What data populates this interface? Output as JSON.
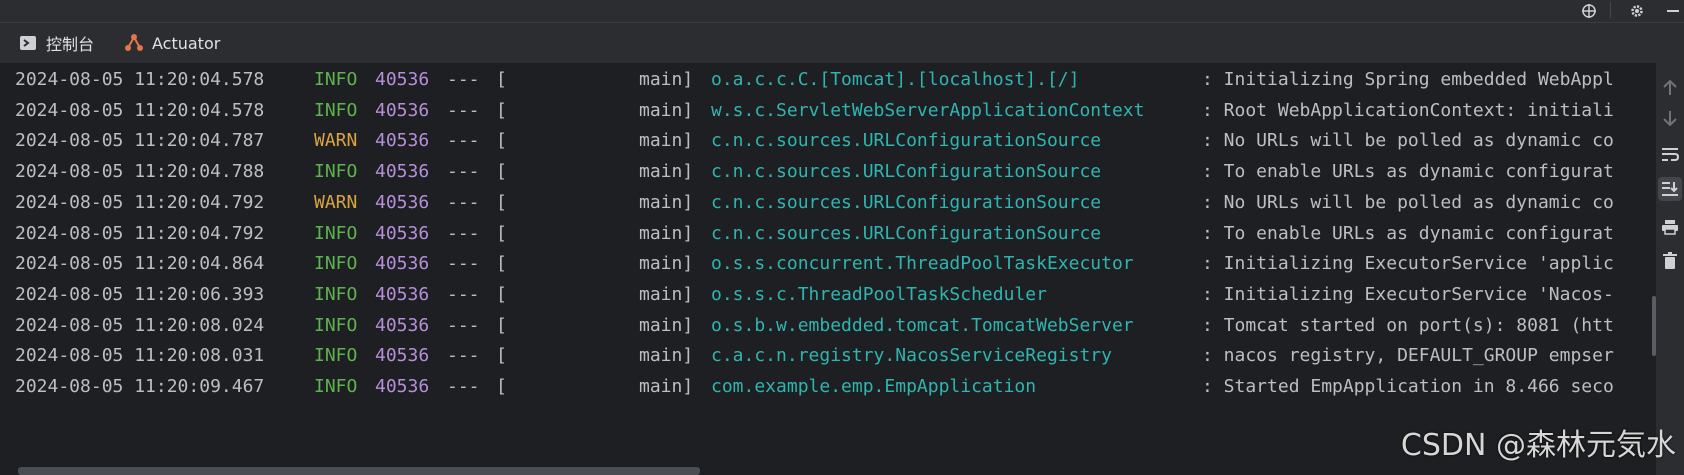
{
  "tabs": [
    {
      "label": "控制台",
      "icon": "console-icon"
    },
    {
      "label": "Actuator",
      "icon": "actuator-icon"
    }
  ],
  "top_icons": [
    "crosshair-icon",
    "gear-icon"
  ],
  "side_icons": [
    "arrow-up-icon",
    "arrow-down-icon",
    "soft-wrap-icon",
    "scroll-to-end-icon",
    "print-icon",
    "trash-icon"
  ],
  "log_lines": [
    {
      "timestamp": "2024-08-05 11:20:04.578",
      "level": "INFO",
      "pid": "40536",
      "sep": "---",
      "bracket": "[",
      "thread": "main]",
      "logger": "o.a.c.c.C.[Tomcat].[localhost].[/]",
      "message": ": Initializing Spring embedded WebAppl"
    },
    {
      "timestamp": "2024-08-05 11:20:04.578",
      "level": "INFO",
      "pid": "40536",
      "sep": "---",
      "bracket": "[",
      "thread": "main]",
      "logger": "w.s.c.ServletWebServerApplicationContext",
      "message": ": Root WebApplicationContext: initiali"
    },
    {
      "timestamp": "2024-08-05 11:20:04.787",
      "level": "WARN",
      "pid": "40536",
      "sep": "---",
      "bracket": "[",
      "thread": "main]",
      "logger": "c.n.c.sources.URLConfigurationSource",
      "message": ": No URLs will be polled as dynamic co"
    },
    {
      "timestamp": "2024-08-05 11:20:04.788",
      "level": "INFO",
      "pid": "40536",
      "sep": "---",
      "bracket": "[",
      "thread": "main]",
      "logger": "c.n.c.sources.URLConfigurationSource",
      "message": ": To enable URLs as dynamic configurat"
    },
    {
      "timestamp": "2024-08-05 11:20:04.792",
      "level": "WARN",
      "pid": "40536",
      "sep": "---",
      "bracket": "[",
      "thread": "main]",
      "logger": "c.n.c.sources.URLConfigurationSource",
      "message": ": No URLs will be polled as dynamic co"
    },
    {
      "timestamp": "2024-08-05 11:20:04.792",
      "level": "INFO",
      "pid": "40536",
      "sep": "---",
      "bracket": "[",
      "thread": "main]",
      "logger": "c.n.c.sources.URLConfigurationSource",
      "message": ": To enable URLs as dynamic configurat"
    },
    {
      "timestamp": "2024-08-05 11:20:04.864",
      "level": "INFO",
      "pid": "40536",
      "sep": "---",
      "bracket": "[",
      "thread": "main]",
      "logger": "o.s.s.concurrent.ThreadPoolTaskExecutor",
      "message": ": Initializing ExecutorService 'applic"
    },
    {
      "timestamp": "2024-08-05 11:20:06.393",
      "level": "INFO",
      "pid": "40536",
      "sep": "---",
      "bracket": "[",
      "thread": "main]",
      "logger": "o.s.s.c.ThreadPoolTaskScheduler",
      "message": ": Initializing ExecutorService 'Nacos-"
    },
    {
      "timestamp": "2024-08-05 11:20:08.024",
      "level": "INFO",
      "pid": "40536",
      "sep": "---",
      "bracket": "[",
      "thread": "main]",
      "logger": "o.s.b.w.embedded.tomcat.TomcatWebServer",
      "message": ": Tomcat started on port(s): 8081 (htt"
    },
    {
      "timestamp": "2024-08-05 11:20:08.031",
      "level": "INFO",
      "pid": "40536",
      "sep": "---",
      "bracket": "[",
      "thread": "main]",
      "logger": "c.a.c.n.registry.NacosServiceRegistry",
      "message": ": nacos registry, DEFAULT_GROUP empser"
    },
    {
      "timestamp": "2024-08-05 11:20:09.467",
      "level": "INFO",
      "pid": "40536",
      "sep": "---",
      "bracket": "[",
      "thread": "main]",
      "logger": "com.example.emp.EmpApplication",
      "message": ": Started EmpApplication in 8.466 seco"
    }
  ],
  "watermark": "CSDN @森林元気水",
  "colors": {
    "info": "#5fb34f",
    "warn": "#d9a343",
    "pid": "#b58fd8",
    "logger": "#2fb5b1",
    "text": "#bcbec4",
    "background": "#1e1f22"
  }
}
